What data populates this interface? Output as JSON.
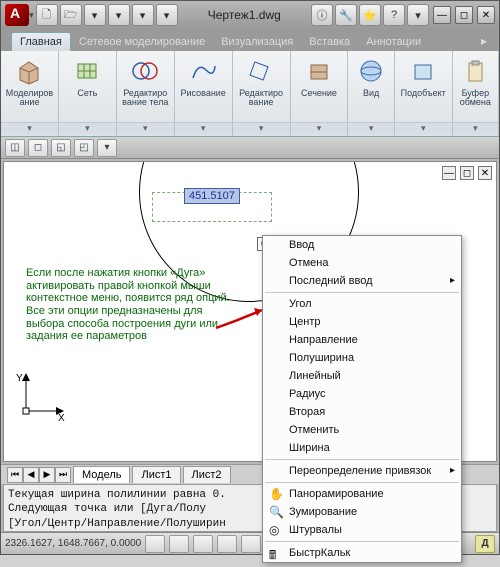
{
  "title": "Чертеж1.dwg",
  "qat": [
    "🗋",
    "🗁",
    "▾",
    "▾",
    "▾",
    "▾"
  ],
  "info_btns": [
    "ⓘ",
    "🔧",
    "⭐",
    "?",
    "▾"
  ],
  "window_btns": [
    "—",
    "◻",
    "✕"
  ],
  "tabs": [
    "Главная",
    "Сетевое моделирование",
    "Визуализация",
    "Вставка",
    "Аннотации"
  ],
  "ribbon": [
    {
      "label": "Моделиров\nание",
      "icon": "cube"
    },
    {
      "label": "Сеть",
      "icon": "mesh"
    },
    {
      "label": "Редактиро\nвание тела",
      "icon": "venn"
    },
    {
      "label": "Рисование",
      "icon": "draw"
    },
    {
      "label": "Редактиро\nвание",
      "icon": "edit"
    },
    {
      "label": "Сечение",
      "icon": "section"
    },
    {
      "label": "Вид",
      "icon": "view"
    },
    {
      "label": "Подобъект",
      "icon": "subobj"
    },
    {
      "label": "Буфер\nобмена",
      "icon": "clip"
    }
  ],
  "dim_value": "451.5107",
  "angle_value": "0°",
  "note_text": "Если после нажатия кнопки «Дуга» активировать правой кнопкой мыши контекстное меню, появится ряд опций. Все эти опции предназначены для выбора способа построения дуги или задания ее параметров",
  "sheets": {
    "model": "Модель",
    "s1": "Лист1",
    "s2": "Лист2"
  },
  "cmd_lines": "Текущая ширина полилинии равна 0.\nСледующая точка или [Дуга/Полу\n[Угол/Центр/Направление/Полуширин\n/Отменить/Ширина]:",
  "status_coords": "2326.1627, 1648.7667, 0.0000",
  "cmd_btn": "Д",
  "ctx": {
    "enter": "Ввод",
    "cancel": "Отмена",
    "recent": "Последний ввод",
    "angle": "Угол",
    "center": "Центр",
    "direction": "Направление",
    "halfwidth": "Полуширина",
    "line": "Линейный",
    "radius": "Радиус",
    "second": "Вторая",
    "undo": "Отменить",
    "width": "Ширина",
    "osnap": "Переопределение привязок",
    "pan": "Панорамирование",
    "zoom": "Зумирование",
    "steering": "Штурвалы",
    "quickcalc": "БыстрКальк"
  }
}
